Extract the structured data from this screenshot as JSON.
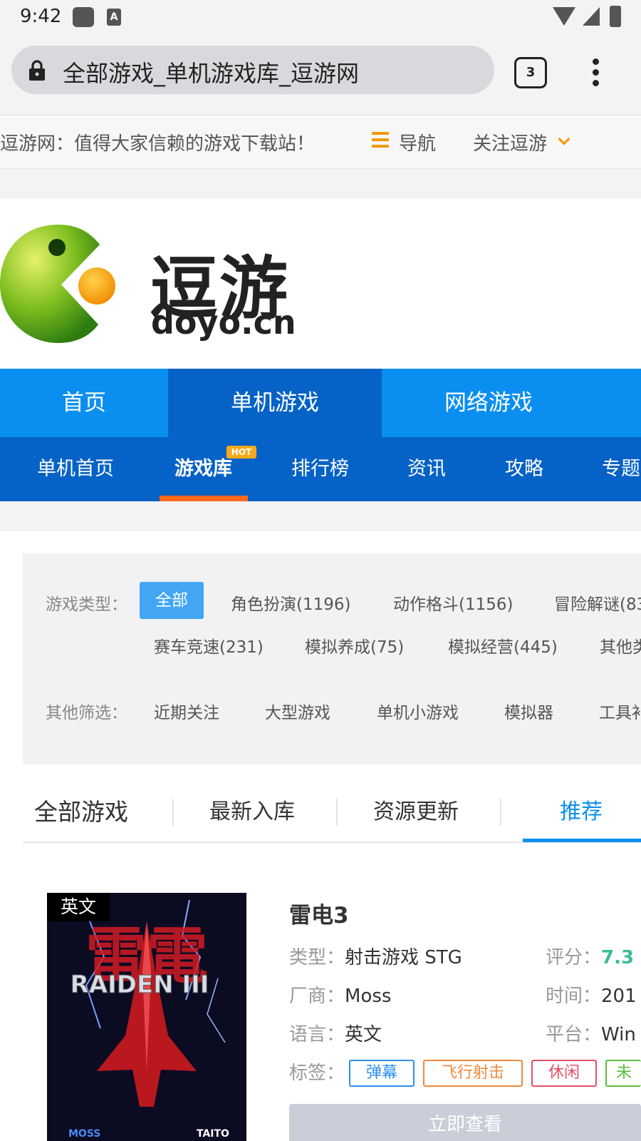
{
  "status_bar": {
    "time": "9:42",
    "icon2_glyph": "A"
  },
  "browser": {
    "url_title": "全部游戏_单机游戏库_逗游网",
    "tab_count": "3"
  },
  "top_bar": {
    "slogan": "逗游网：值得大家信赖的游戏下载站！",
    "nav_label": "导航",
    "follow_label": "关注逗游"
  },
  "logo": {
    "cn": "逗游",
    "en": "doyo.cn"
  },
  "main_nav": [
    "首页",
    "单机游戏",
    "网络游戏"
  ],
  "sub_nav": [
    "单机首页",
    "游戏库",
    "排行榜",
    "资讯",
    "攻略",
    "专题"
  ],
  "hot_badge": "HOT",
  "filters": {
    "type_label": "游戏类型：",
    "type_options": [
      "全部",
      "角色扮演(1196)",
      "动作格斗(1156)",
      "冒险解谜(83",
      "赛车竞速(231)",
      "模拟养成(75)",
      "模拟经营(445)",
      "其他类"
    ],
    "other_label": "其他筛选：",
    "other_options": [
      "近期关注",
      "大型游戏",
      "单机小游戏",
      "模拟器",
      "工具补"
    ]
  },
  "list_tabs": [
    "全部游戏",
    "最新入库",
    "资源更新",
    "推荐"
  ],
  "game": {
    "lang_badge": "英文",
    "title": "雷电3",
    "type_k": "类型：",
    "type_v": "射击游戏 STG",
    "score_k": "评分：",
    "score_v": "7.3",
    "vendor_k": "厂商：",
    "vendor_v": "Moss",
    "time_k": "时间：",
    "time_v": "201",
    "lang_k": "语言：",
    "lang_v": "英文",
    "platform_k": "平台：",
    "platform_v": "Win",
    "tags_k": "标签：",
    "tags": [
      "弹幕",
      "飞行射击",
      "休闲",
      "未"
    ],
    "view_button": "立即查看",
    "cover_text": "RAIDEN III",
    "cover_cn": "雷電",
    "cover_vendor": "MOSS",
    "cover_pub": "TAITO"
  },
  "colors": {
    "brand_blue": "#0a8ff0",
    "nav_dark": "#0562c6",
    "accent_orange": "#ff6a1a",
    "score_green": "#3dbb96"
  }
}
